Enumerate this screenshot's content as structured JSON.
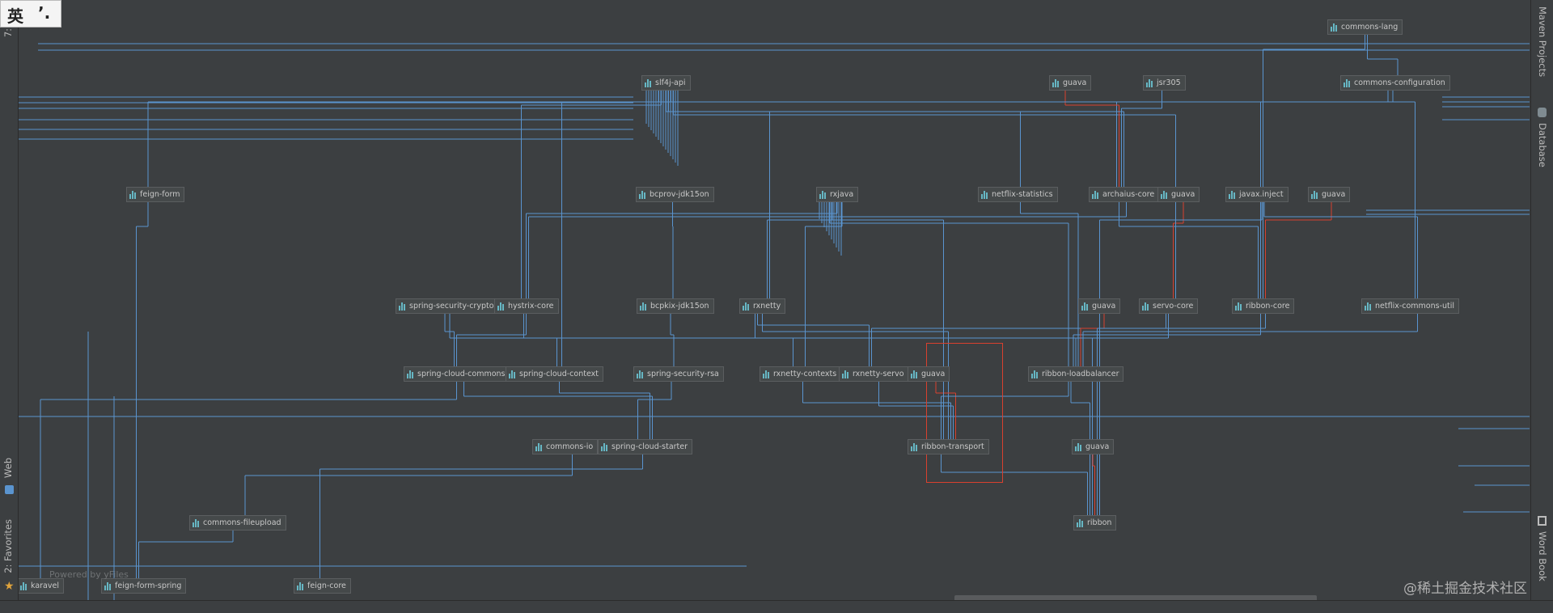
{
  "left_panel": {
    "structure_tab": "7: S",
    "web_tab": "Web",
    "favorites_tab": "2: Favorites"
  },
  "right_panel": {
    "maven_tab": "Maven Projects",
    "database_tab": "Database",
    "wordbook_tab": "Word Book"
  },
  "ime": {
    "lang": "英",
    "punct": "’."
  },
  "diagram": {
    "powered_by": "Powered by yFiles",
    "edge_color": "#5a94cf",
    "conflict_color": "#d9402e",
    "nodes": [
      {
        "id": "commons-lang",
        "label": "commons-lang"
      },
      {
        "id": "slf4j-api",
        "label": "slf4j-api"
      },
      {
        "id": "guava-top",
        "label": "guava"
      },
      {
        "id": "jsr305",
        "label": "jsr305"
      },
      {
        "id": "commons-configuration",
        "label": "commons-configuration"
      },
      {
        "id": "feign-form",
        "label": "feign-form"
      },
      {
        "id": "bcprov-jdk15on",
        "label": "bcprov-jdk15on"
      },
      {
        "id": "rxjava",
        "label": "rxjava"
      },
      {
        "id": "netflix-statistics",
        "label": "netflix-statistics"
      },
      {
        "id": "archaius-core",
        "label": "archaius-core"
      },
      {
        "id": "guava-2",
        "label": "guava"
      },
      {
        "id": "javax-inject",
        "label": "javax.inject"
      },
      {
        "id": "guava-3",
        "label": "guava"
      },
      {
        "id": "spring-security-crypto",
        "label": "spring-security-crypto"
      },
      {
        "id": "hystrix-core",
        "label": "hystrix-core"
      },
      {
        "id": "bcpkix-jdk15on",
        "label": "bcpkix-jdk15on"
      },
      {
        "id": "rxnetty",
        "label": "rxnetty"
      },
      {
        "id": "guava-4",
        "label": "guava"
      },
      {
        "id": "servo-core",
        "label": "servo-core"
      },
      {
        "id": "ribbon-core",
        "label": "ribbon-core"
      },
      {
        "id": "netflix-commons-util",
        "label": "netflix-commons-util"
      },
      {
        "id": "spring-cloud-commons",
        "label": "spring-cloud-commons"
      },
      {
        "id": "spring-cloud-context",
        "label": "spring-cloud-context"
      },
      {
        "id": "spring-security-rsa",
        "label": "spring-security-rsa"
      },
      {
        "id": "rxnetty-contexts",
        "label": "rxnetty-contexts"
      },
      {
        "id": "rxnetty-servo",
        "label": "rxnetty-servo"
      },
      {
        "id": "guava-5",
        "label": "guava"
      },
      {
        "id": "ribbon-loadbalancer",
        "label": "ribbon-loadbalancer"
      },
      {
        "id": "commons-io",
        "label": "commons-io"
      },
      {
        "id": "spring-cloud-starter",
        "label": "spring-cloud-starter"
      },
      {
        "id": "ribbon-transport",
        "label": "ribbon-transport"
      },
      {
        "id": "guava-6",
        "label": "guava"
      },
      {
        "id": "commons-fileupload",
        "label": "commons-fileupload"
      },
      {
        "id": "ribbon",
        "label": "ribbon"
      },
      {
        "id": "feign-form-spring",
        "label": "feign-form-spring"
      },
      {
        "id": "feign-core",
        "label": "feign-core"
      },
      {
        "id": "karavel",
        "label": "karavel"
      }
    ]
  },
  "watermark": "@稀土掘金技术社区"
}
